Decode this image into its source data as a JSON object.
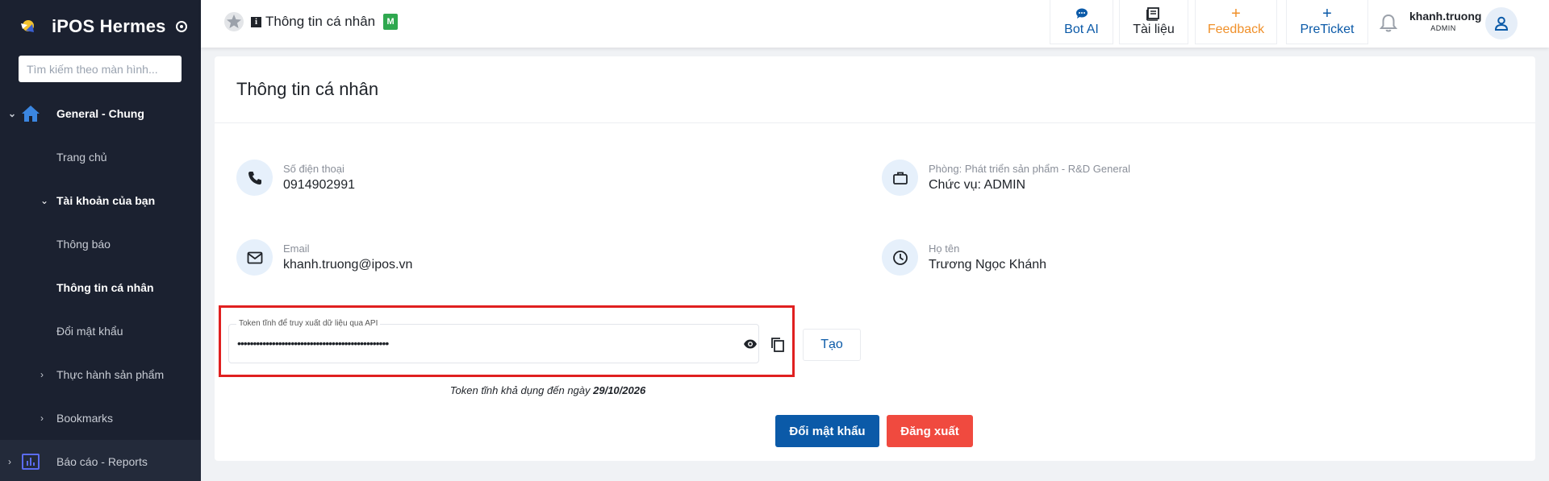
{
  "sidebar": {
    "brand": "iPOS Hermes",
    "search_placeholder": "Tìm kiếm theo màn hình...",
    "items": [
      {
        "label": "General - Chung"
      },
      {
        "label": "Trang chủ"
      },
      {
        "label": "Tài khoản của bạn"
      },
      {
        "label": "Thông báo"
      },
      {
        "label": "Thông tin cá nhân"
      },
      {
        "label": "Đổi mật khẩu"
      },
      {
        "label": "Thực hành sản phẩm"
      },
      {
        "label": "Bookmarks"
      },
      {
        "label": "Báo cáo - Reports"
      }
    ]
  },
  "topbar": {
    "page_title": "Thông tin cá nhân",
    "badge": "M",
    "info_glyph": "i",
    "buttons": {
      "bot_ai": "Bot AI",
      "docs": "Tài liệu",
      "feedback": "Feedback",
      "preticket": "PreTicket"
    },
    "user": {
      "name": "khanh.truong",
      "role": "ADMIN"
    }
  },
  "card": {
    "title": "Thông tin cá nhân",
    "phone": {
      "label": "Số điện thoại",
      "value": "0914902991"
    },
    "department": {
      "label": "Phòng: Phát triển sản phẩm - R&D General",
      "value": "Chức vụ: ADMIN"
    },
    "email": {
      "label": "Email",
      "value": "khanh.truong@ipos.vn"
    },
    "fullname": {
      "label": "Họ tên",
      "value": "Trương Ngọc Khánh"
    },
    "token": {
      "label": "Token tĩnh để truy xuất dữ liệu qua API",
      "masked": "••••••••••••••••••••••••••••••••••••••••••••••••",
      "create": "Tạo",
      "avail_prefix": "Token tĩnh khả dụng đến ngày ",
      "avail_date": "29/10/2026"
    },
    "change_password": "Đổi mật khẩu",
    "logout": "Đăng xuất"
  },
  "colors": {
    "sidebar_bg": "#1b2130",
    "primary": "#0b5aa8",
    "danger": "#f04a3f",
    "feedback": "#f0902a",
    "highlight": "#e02020"
  }
}
